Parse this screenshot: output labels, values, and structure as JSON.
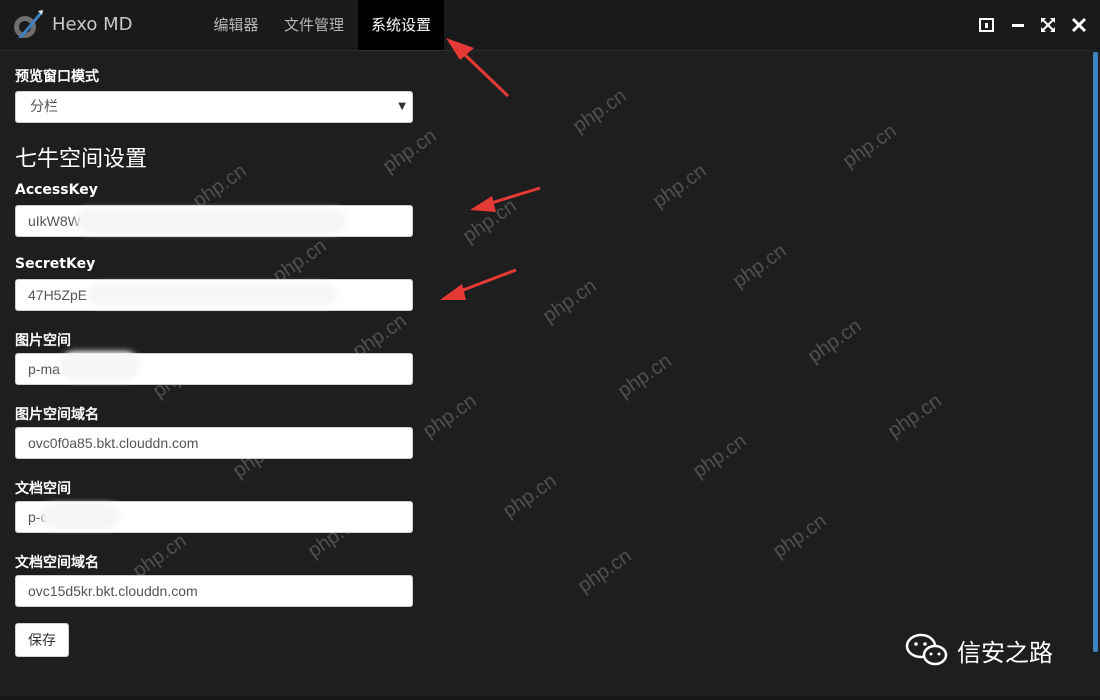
{
  "app": {
    "title": "Hexo MD"
  },
  "tabs": [
    {
      "label": "编辑器"
    },
    {
      "label": "文件管理"
    },
    {
      "label": "系统设置",
      "active": true
    }
  ],
  "settings": {
    "preview_mode": {
      "label": "预览窗口模式",
      "selected": "分栏"
    },
    "qiniu_section_title": "七牛空间设置",
    "access_key": {
      "label": "AccessKey",
      "value": "uIkW8W"
    },
    "secret_key": {
      "label": "SecretKey",
      "value": "47H5ZpE"
    },
    "image_bucket": {
      "label": "图片空间",
      "value": "p-ma"
    },
    "image_domain": {
      "label": "图片空间域名",
      "value": "ovc0f0a85.bkt.clouddn.com"
    },
    "doc_bucket": {
      "label": "文档空间",
      "value": "p-c"
    },
    "doc_domain": {
      "label": "文档空间域名",
      "value": "ovc15d5kr.bkt.clouddn.com"
    },
    "save_label": "保存"
  },
  "watermark_text": "php.cn",
  "footer": {
    "brand": "信安之路"
  },
  "colors": {
    "accent": "#3e82c4",
    "annotation_arrow": "#e53935",
    "background": "#1e1e1e"
  }
}
